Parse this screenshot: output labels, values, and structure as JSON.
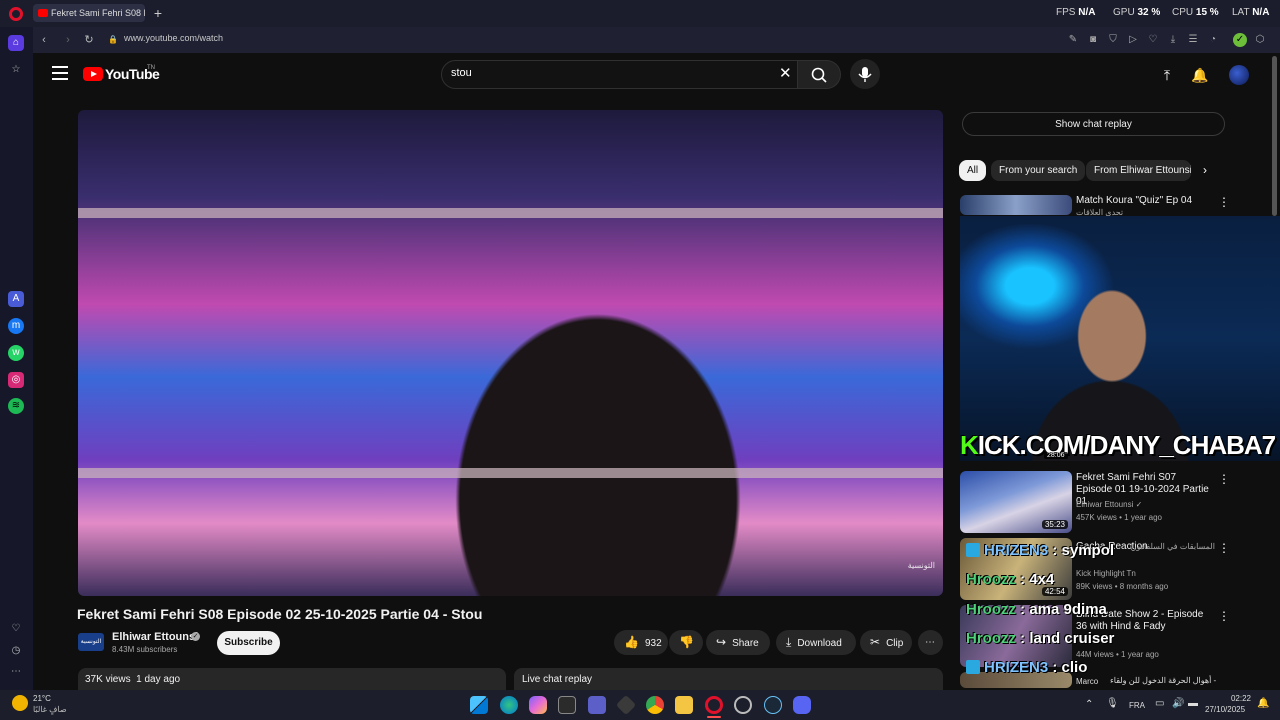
{
  "browser": {
    "tab_title": "Fekret Sami Fehri S08 Epis",
    "new_tab_icon": "plus-icon",
    "url": "www.youtube.com/watch",
    "perf": {
      "fps_label": "FPS",
      "fps_value": "N/A",
      "gpu_label": "GPU",
      "gpu_value": "32 %",
      "cpu_label": "CPU",
      "cpu_value": "15 %",
      "lat_label": "LAT",
      "lat_value": "N/A"
    }
  },
  "youtube": {
    "logo_text": "YouTube",
    "logo_suffix": "TN",
    "search": {
      "value": "stou"
    },
    "video": {
      "title": "Fekret Sami Fehri S08 Episode 02 25-10-2025 Partie 04 - Stou",
      "channel": "Elhiwar Ettounsi",
      "subscribers": "8.43M subscribers",
      "subscribe_label": "Subscribe",
      "likes": "932",
      "share_label": "Share",
      "download_label": "Download",
      "clip_label": "Clip",
      "views": "37K views",
      "age": "1 day ago",
      "watermark": "التونسية"
    },
    "live_chat_replay": "Live chat replay",
    "show_chat_replay": "Show chat replay",
    "chips": [
      "All",
      "From your search",
      "From Elhiwar Ettounsi"
    ],
    "recommendations": [
      {
        "title": "Match Koura \"Quiz\" Ep 04",
        "subtitle": "تحدي العلاقات"
      },
      {
        "title": "Fekret Sami Fehri S07 Episode 01 19-10-2024 Partie 01",
        "channel": "Elhiwar Ettounsi",
        "views": "457K views",
        "age": "1 year ago",
        "duration": "35:23"
      },
      {
        "title": "Gacha Reaction",
        "title_ar": "دخلت أخطر سجن - بالعالم ! (سجن المسابقات في السلفادور) sv",
        "channel": "Kick Highlight Tn",
        "views": "89K views",
        "age": "8 months ago",
        "duration": "42:54"
      },
      {
        "title": "Blind Date Show 2 - Episode 36 with Hind & Fady",
        "views": "44M views",
        "age": "1 year ago"
      },
      {
        "title": "أهوال الحرقة الدخول للن ولقاء -",
        "channel": "Marco"
      }
    ],
    "overlay_duration": "28:06"
  },
  "stream_overlay": {
    "kick_k": "K",
    "kick_rest": "ICK.COM/DANY_CHABA7",
    "chat": [
      {
        "user": "HRIZEN3",
        "msg": "sympol"
      },
      {
        "user": "Hroozz",
        "msg": "4x4"
      },
      {
        "user": "Hroozz",
        "msg": "ama 9dima"
      },
      {
        "user": "Hroozz",
        "msg": "land cruiser"
      },
      {
        "user": "HRIZEN3",
        "msg": "clio"
      }
    ]
  },
  "taskbar": {
    "weather_temp": "21°C",
    "weather_desc": "صافٍ غالبًا",
    "language": "FRA",
    "time": "02:22",
    "date": "27/10/2025"
  },
  "colors": {
    "youtube_red": "#ff0000",
    "kick_green": "#53fc18",
    "background": "#0f0f0f"
  }
}
